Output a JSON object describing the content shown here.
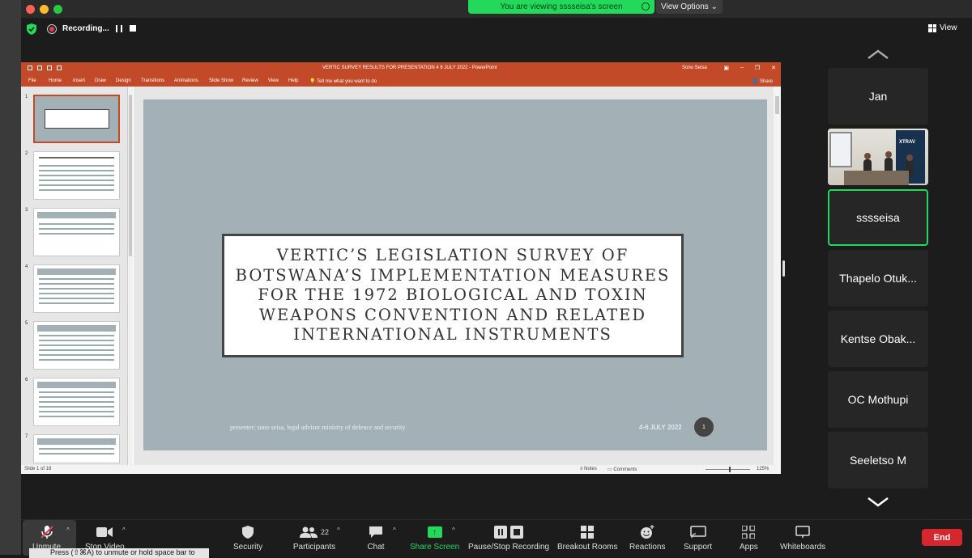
{
  "banner": {
    "viewing": "You are viewing sssseisa's screen",
    "view_options": "View Options"
  },
  "recording": {
    "label": "Recording..."
  },
  "view": {
    "label": "View"
  },
  "ppt": {
    "title": "VERTIC SURVEY RESULTS FOR PRESENTATION 4  6 JULY 2022  -  PowerPoint",
    "user": "Sono Seisa",
    "menu": [
      "File",
      "Home",
      "Insert",
      "Draw",
      "Design",
      "Transitions",
      "Animations",
      "Slide Show",
      "Review",
      "View",
      "Help"
    ],
    "tell": "Tell me what you want to do",
    "share": "Share",
    "thumb_numbers": [
      "1",
      "2",
      "3",
      "4",
      "5",
      "6",
      "7"
    ],
    "slide": {
      "title_lines": [
        "VERTIC’S LEGISLATION SURVEY OF",
        "BOTSWANA’S IMPLEMENTATION MEASURES",
        "FOR THE 1972 BIOLOGICAL AND TOXIN",
        "WEAPONS CONVENTION AND RELATED",
        "INTERNATIONAL INSTRUMENTS"
      ],
      "presenter": "presenter: sono seisa, legal advisor ministry of defence and security",
      "date": "4-6 JULY 2022",
      "number": "1"
    },
    "status": {
      "slide_count": "Slide 1 of 18",
      "notes": "Notes",
      "comments": "Comments",
      "zoom": "125%"
    }
  },
  "participants": [
    "Jan",
    "",
    "sssseisa",
    "Thapelo Otuk...",
    "Kentse Obak...",
    "OC Mothupi",
    "Seeletso M"
  ],
  "video_tile": {
    "banner_text": "XTRAV"
  },
  "toolbar": {
    "unmute": "Unmute",
    "stop_video": "Stop Video",
    "security": "Security",
    "participants": "Participants",
    "participant_count": "22",
    "chat": "Chat",
    "share_screen": "Share Screen",
    "pause_recording": "Pause/Stop Recording",
    "breakout": "Breakout Rooms",
    "reactions": "Reactions",
    "support": "Support",
    "apps": "Apps",
    "whiteboards": "Whiteboards",
    "end": "End"
  },
  "tooltip": "Press (⇧⌘A) to unmute or hold space bar to"
}
